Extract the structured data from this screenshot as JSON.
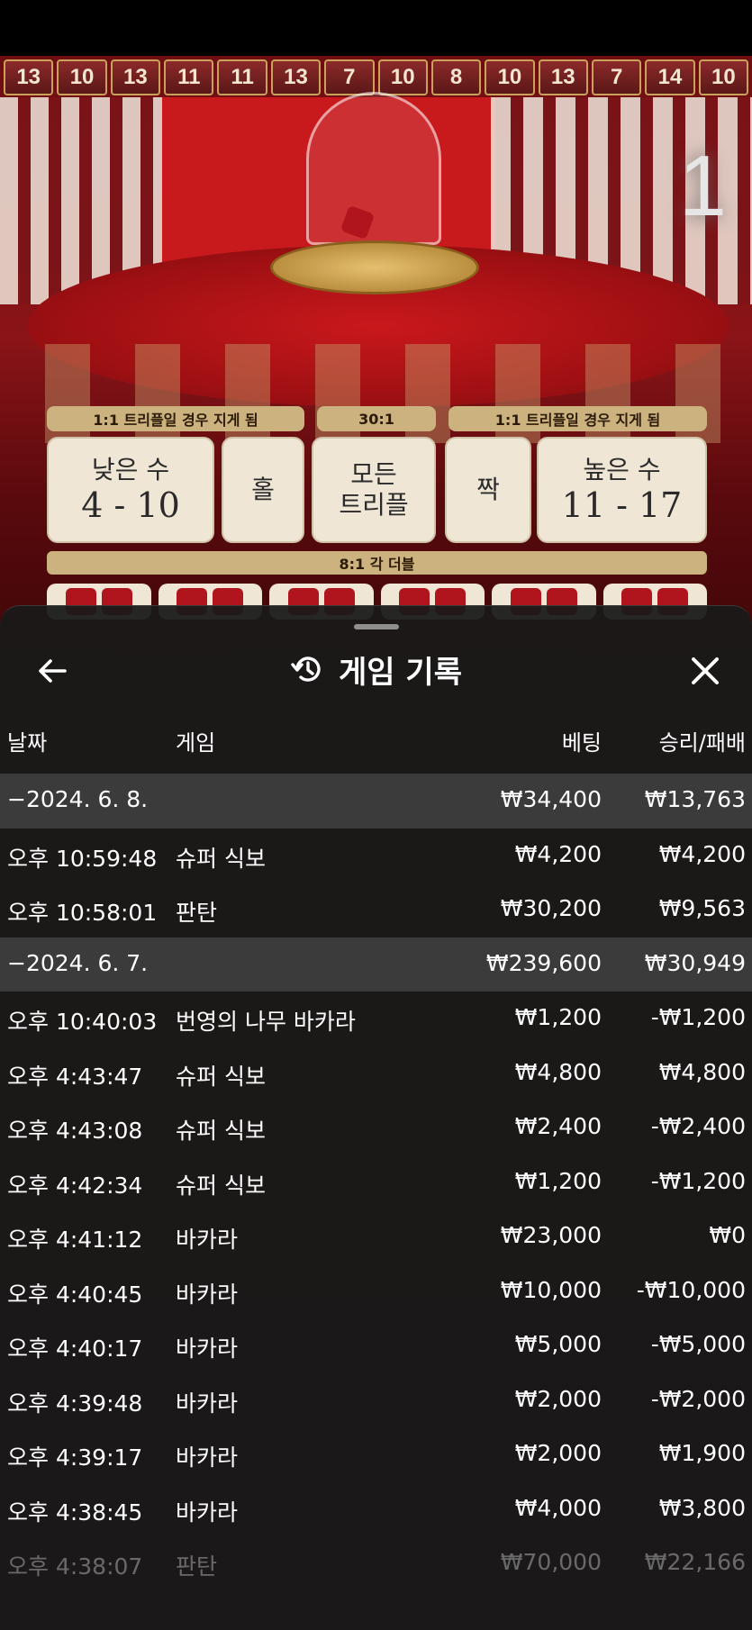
{
  "game_scene": {
    "result_history": [
      "13",
      "10",
      "13",
      "11",
      "11",
      "13",
      "7",
      "10",
      "8",
      "10",
      "13",
      "7",
      "14",
      "10"
    ],
    "round_number": "1",
    "payout_labels": {
      "left": "1:1 트리플일 경우 지게 됨",
      "center": "30:1",
      "right": "1:1 트리플일 경우 지게 됨",
      "double": "8:1 각 더블"
    },
    "bets": {
      "small_label": "낮은 수",
      "small_range": "4 - 10",
      "odd": "홀",
      "any_triple": "모든\n트리플",
      "even": "짝",
      "big_label": "높은 수",
      "big_range": "11 - 17"
    }
  },
  "sheet": {
    "title": "게임 기록",
    "columns": {
      "date": "날짜",
      "game": "게임",
      "bet": "베팅",
      "winloss": "승리/패배"
    },
    "rows": [
      {
        "type": "group",
        "date": "−2024. 6. 8.",
        "game": "",
        "bet": "₩34,400",
        "winloss": "₩13,763"
      },
      {
        "type": "item",
        "date": "오후 10:59:48",
        "game": "슈퍼 식보",
        "bet": "₩4,200",
        "winloss": "₩4,200"
      },
      {
        "type": "item",
        "date": "오후 10:58:01",
        "game": "판탄",
        "bet": "₩30,200",
        "winloss": "₩9,563"
      },
      {
        "type": "group",
        "date": "−2024. 6. 7.",
        "game": "",
        "bet": "₩239,600",
        "winloss": "₩30,949"
      },
      {
        "type": "item",
        "date": "오후 10:40:03",
        "game": "번영의 나무 바카라",
        "bet": "₩1,200",
        "winloss": "-₩1,200"
      },
      {
        "type": "item",
        "date": "오후 4:43:47",
        "game": "슈퍼 식보",
        "bet": "₩4,800",
        "winloss": "₩4,800"
      },
      {
        "type": "item",
        "date": "오후 4:43:08",
        "game": "슈퍼 식보",
        "bet": "₩2,400",
        "winloss": "-₩2,400"
      },
      {
        "type": "item",
        "date": "오후 4:42:34",
        "game": "슈퍼 식보",
        "bet": "₩1,200",
        "winloss": "-₩1,200"
      },
      {
        "type": "item",
        "date": "오후 4:41:12",
        "game": "바카라",
        "bet": "₩23,000",
        "winloss": "₩0"
      },
      {
        "type": "item",
        "date": "오후 4:40:45",
        "game": "바카라",
        "bet": "₩10,000",
        "winloss": "-₩10,000"
      },
      {
        "type": "item",
        "date": "오후 4:40:17",
        "game": "바카라",
        "bet": "₩5,000",
        "winloss": "-₩5,000"
      },
      {
        "type": "item",
        "date": "오후 4:39:48",
        "game": "바카라",
        "bet": "₩2,000",
        "winloss": "-₩2,000"
      },
      {
        "type": "item",
        "date": "오후 4:39:17",
        "game": "바카라",
        "bet": "₩2,000",
        "winloss": "₩1,900"
      },
      {
        "type": "item",
        "date": "오후 4:38:45",
        "game": "바카라",
        "bet": "₩4,000",
        "winloss": "₩3,800"
      },
      {
        "type": "item",
        "date": "오후 4:38:07",
        "game": "판탄",
        "bet": "₩70,000",
        "winloss": "₩22,166"
      }
    ]
  },
  "icons": {
    "back": "arrow-left-icon",
    "history": "history-clock-icon",
    "close": "close-icon"
  }
}
